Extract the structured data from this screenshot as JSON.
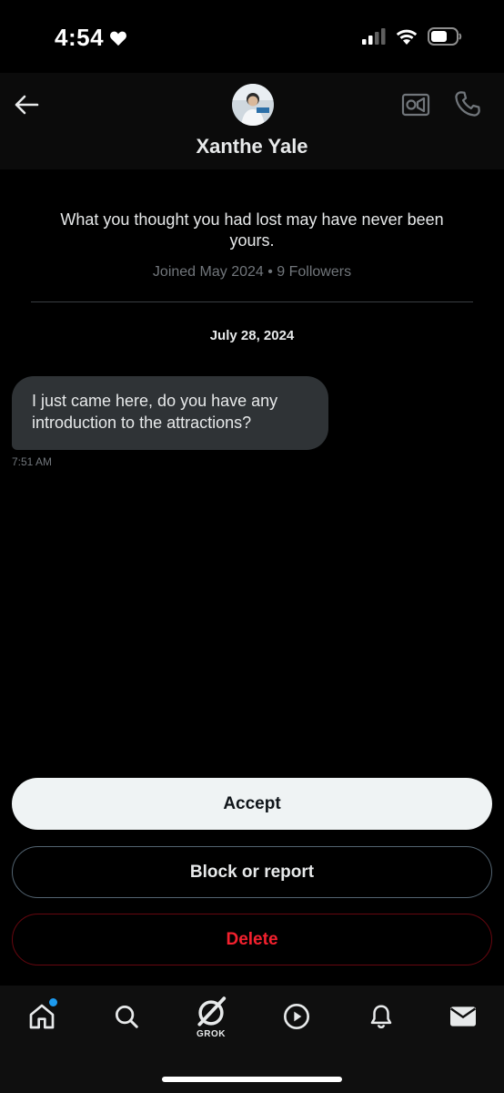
{
  "status_bar": {
    "time": "4:54"
  },
  "header": {
    "contact_name": "Xanthe Yale"
  },
  "profile": {
    "bio": "What you thought you had lost may have never been yours.",
    "meta": "Joined May 2024 • 9 Followers"
  },
  "conversation": {
    "date": "July 28, 2024",
    "messages": [
      {
        "text": "I just came here, do you have any introduction to the attractions?",
        "time": "7:51 AM"
      }
    ]
  },
  "actions": {
    "accept": "Accept",
    "block_or_report": "Block or report",
    "delete": "Delete"
  },
  "tabbar": {
    "grok_label": "GROK",
    "tabs": [
      "home-icon",
      "search-icon",
      "grok-icon",
      "play-icon",
      "bell-icon",
      "mail-icon"
    ]
  },
  "colors": {
    "accent": "#1d9bf0",
    "danger": "#f4212e",
    "bubble": "#2f3336"
  }
}
